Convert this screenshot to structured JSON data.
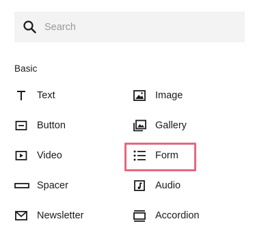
{
  "search": {
    "placeholder": "Search",
    "value": "",
    "icon": "search-icon"
  },
  "section": {
    "label": "Basic"
  },
  "blocks": {
    "text": {
      "label": "Text",
      "icon": "text-icon"
    },
    "image": {
      "label": "Image",
      "icon": "image-icon"
    },
    "button": {
      "label": "Button",
      "icon": "button-icon"
    },
    "gallery": {
      "label": "Gallery",
      "icon": "gallery-icon"
    },
    "video": {
      "label": "Video",
      "icon": "video-icon"
    },
    "form": {
      "label": "Form",
      "icon": "form-icon",
      "highlighted": true
    },
    "spacer": {
      "label": "Spacer",
      "icon": "spacer-icon"
    },
    "audio": {
      "label": "Audio",
      "icon": "audio-icon"
    },
    "newsletter": {
      "label": "Newsletter",
      "icon": "newsletter-icon"
    },
    "accordion": {
      "label": "Accordion",
      "icon": "accordion-icon"
    }
  },
  "colors": {
    "highlight": "#e2687f",
    "search_bg": "#f3f3f3",
    "text": "#1a1a1a",
    "placeholder": "#9a9a9a"
  }
}
